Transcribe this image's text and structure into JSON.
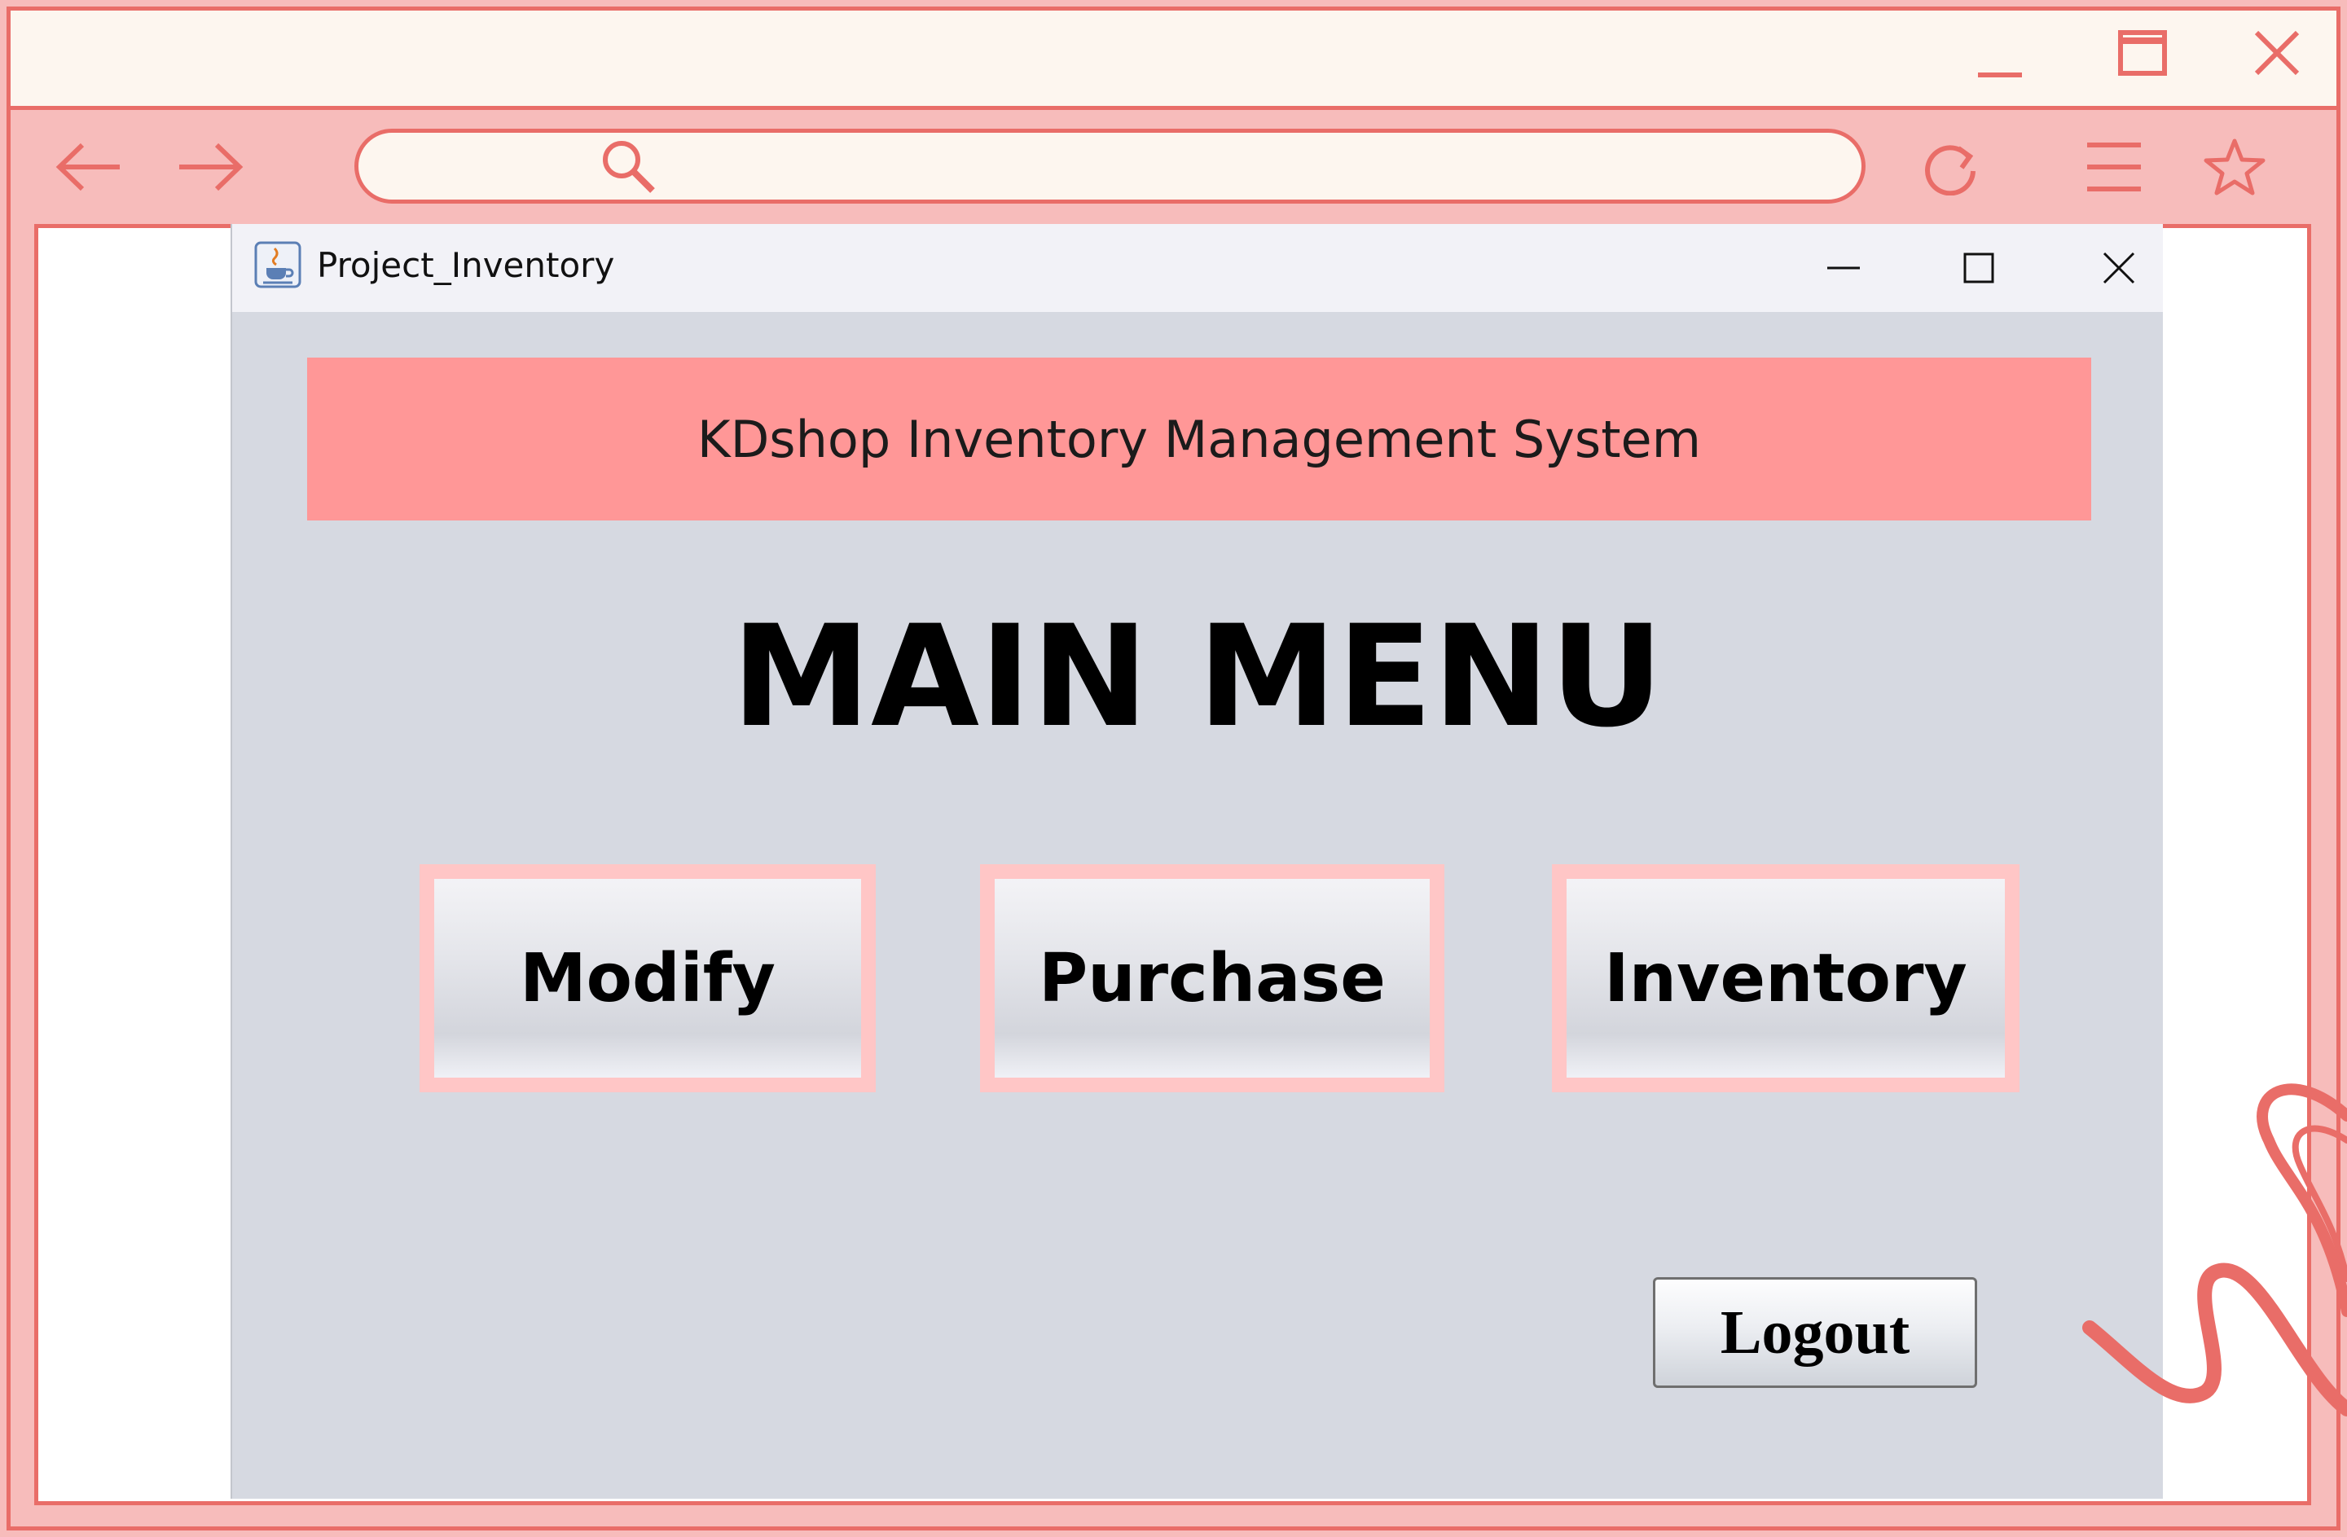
{
  "browser": {
    "address_value": "",
    "controls": [
      "minimize-icon",
      "maximize-icon",
      "close-icon"
    ],
    "nav": [
      "back-arrow-icon",
      "forward-arrow-icon",
      "search-icon",
      "refresh-icon",
      "menu-icon",
      "star-icon"
    ],
    "accent_color": "#e96d68",
    "bar_color": "#fdf6ef",
    "frame_fill": "#f7bcbb"
  },
  "app_window": {
    "title": "Project_Inventory",
    "icon": "java-cup-icon",
    "controls": [
      "minimize-icon",
      "maximize-icon",
      "close-icon"
    ],
    "background": "#d6d9e1"
  },
  "header": {
    "title": "KDshop Inventory Management System",
    "background": "#ff9797"
  },
  "main": {
    "heading": "MAIN MENU",
    "buttons": [
      {
        "label": "Modify"
      },
      {
        "label": "Purchase"
      },
      {
        "label": "Inventory"
      }
    ],
    "button_border_color": "#ffc6c6",
    "logout_label": "Logout"
  }
}
